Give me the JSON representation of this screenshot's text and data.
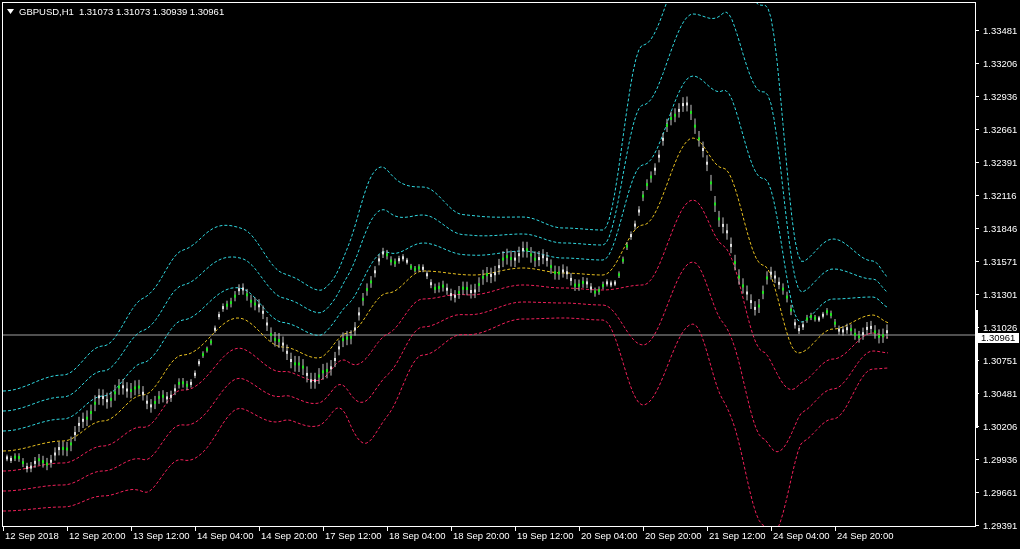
{
  "chart": {
    "symbol": "GBPUSD,H1",
    "quotes": "1.31073 1.31073 1.30939 1.30961",
    "price_axis": [
      "1.33481",
      "1.33206",
      "1.32936",
      "1.32661",
      "1.32391",
      "1.32116",
      "1.31846",
      "1.31571",
      "1.31301",
      "1.31026",
      "1.30751",
      "1.30481",
      "1.30206",
      "1.29936",
      "1.29661",
      "1.29391"
    ],
    "current_price": "1.30961",
    "time_axis": [
      "12 Sep 2018",
      "12 Sep 20:00",
      "13 Sep 12:00",
      "14 Sep 04:00",
      "14 Sep 20:00",
      "17 Sep 12:00",
      "18 Sep 04:00",
      "18 Sep 20:00",
      "19 Sep 12:00",
      "20 Sep 04:00",
      "20 Sep 20:00",
      "21 Sep 12:00",
      "24 Sep 04:00",
      "24 Sep 20:00"
    ]
  }
}
